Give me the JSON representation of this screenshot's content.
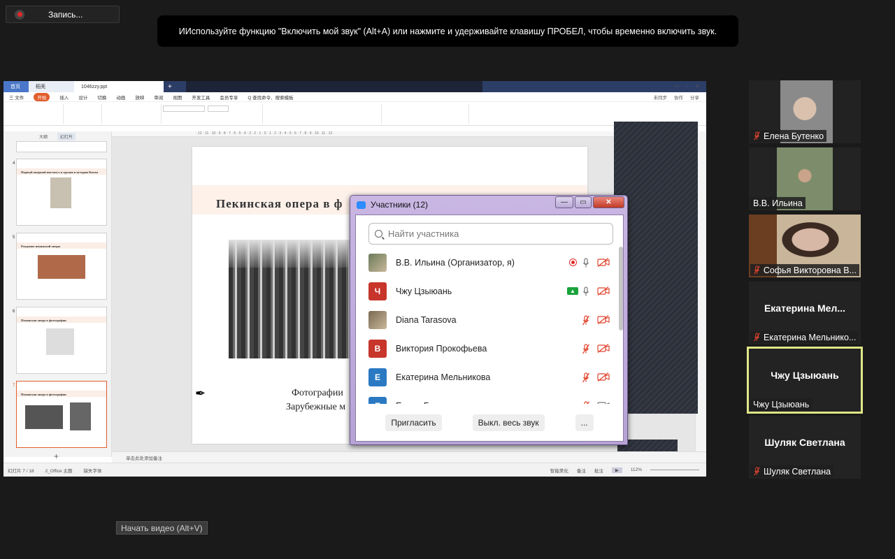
{
  "recording": {
    "label": "Запись..."
  },
  "unmute_tip": {
    "text": "ИИспользуйте функцию \"Включить мой звук\" (Alt+A) или нажмите и удерживайте клавишу ПРОБЕЛ, чтобы временно включить звук."
  },
  "start_video_tooltip": "Начать видео (Alt+V)",
  "wps": {
    "tabs": [
      "首页",
      "稻壳",
      "1046zzy.ppt"
    ],
    "menu": [
      "三 文件",
      "开始",
      "插入",
      "设计",
      "切换",
      "动画",
      "放映",
      "审阅",
      "视图",
      "开发工具",
      "会员专享",
      "Q 查找命令、搜索模板"
    ],
    "menu_right": [
      "未同步",
      "协作",
      "分享"
    ],
    "panel_tabs": [
      "大纲",
      "幻灯片"
    ],
    "slide_numbers": [
      "4",
      "5",
      "6",
      "7"
    ],
    "thumb_titles": [
      "Первый оперный институт и труппа в истории Китая",
      "Рождение пекинской оперы",
      "Пекинская опера в фотографии",
      "Пекинская опера в фотографии"
    ],
    "notes_placeholder": "单击此处添加备注",
    "status_left": [
      "幻灯片 7 / 18",
      "2_Office 主题",
      "缺失字体"
    ],
    "status_right": [
      "智能美化",
      "备注",
      "批注",
      "112%"
    ],
    "slide": {
      "title": "Пекинская опера в ф",
      "caption_line1": "Фотографии",
      "caption_line2": "Зарубежные м"
    }
  },
  "participants": {
    "window_title": "Участники (12)",
    "search_placeholder": "Найти участника",
    "rows": [
      {
        "name": "В.В. Ильина (Организатор, я)",
        "avatar": "photo",
        "avatar_color": "#6b7b5a",
        "recording": true,
        "mic_muted": false,
        "cam_off": true
      },
      {
        "name": "Чжу Цзыюань",
        "avatar": "Ч",
        "avatar_color": "#c7352b",
        "sharing": true,
        "mic_muted": false,
        "cam_off": true
      },
      {
        "name": "Diana Tarasova",
        "avatar": "photo",
        "avatar_color": "#7a6a52",
        "mic_muted": true,
        "cam_off": true
      },
      {
        "name": "Виктория Прокофьева",
        "avatar": "В",
        "avatar_color": "#c7352b",
        "mic_muted": true,
        "cam_off": true
      },
      {
        "name": "Екатерина Мельникова",
        "avatar": "Е",
        "avatar_color": "#2a79c2",
        "mic_muted": true,
        "cam_off": true
      },
      {
        "name": "Елена Бутенко",
        "avatar": "Е",
        "avatar_color": "#2a79c2",
        "mic_muted": true,
        "cam_off": false
      }
    ],
    "buttons": {
      "invite": "Пригласить",
      "mute_all": "Выкл. весь звук",
      "more": "..."
    }
  },
  "gallery": [
    {
      "name": "Елена Бутенко",
      "video": true,
      "muted": true
    },
    {
      "name": "В.В. Ильина",
      "video": true,
      "muted": false
    },
    {
      "name": "Софья Викторовна В...",
      "video": true,
      "muted": true
    },
    {
      "name": "Екатерина Мельнико...",
      "big_name": "Екатерина  Мел...",
      "video": false,
      "muted": true
    },
    {
      "name": "Чжу Цзыюань",
      "big_name": "Чжу Цзыюань",
      "video": false,
      "muted": false,
      "speaking": true
    },
    {
      "name": "Шуляк Светлана",
      "big_name": "Шуляк Светлана",
      "video": false,
      "muted": true
    }
  ],
  "colors": {
    "accent_red": "#e02828",
    "speaking_border": "#dfe787",
    "zoom_blue": "#2d8cff",
    "share_green": "#1aa33a"
  }
}
